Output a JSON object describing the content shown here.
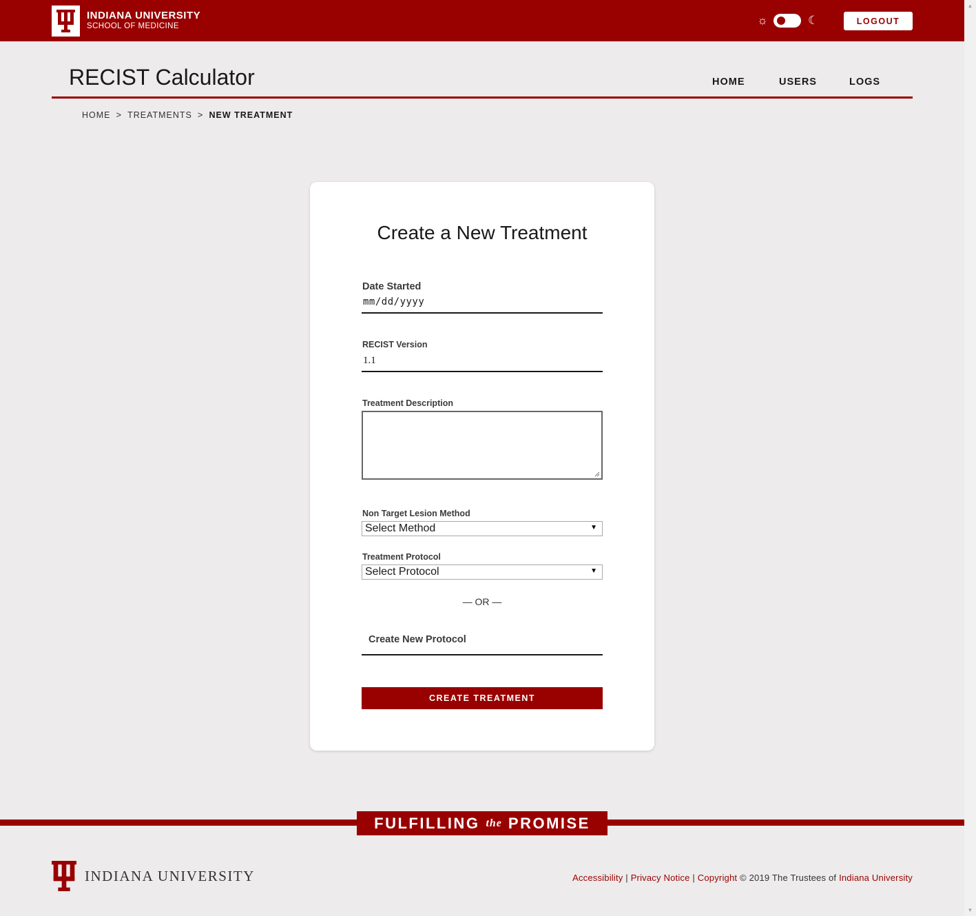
{
  "header": {
    "brand_line1": "INDIANA UNIVERSITY",
    "brand_line2": "SCHOOL OF MEDICINE",
    "logout_label": "LOGOUT",
    "brand_color": "#990000"
  },
  "site": {
    "title": "RECIST Calculator"
  },
  "nav": {
    "items": [
      {
        "label": "HOME"
      },
      {
        "label": "USERS"
      },
      {
        "label": "LOGS"
      }
    ]
  },
  "breadcrumb": {
    "items": [
      "HOME",
      "TREATMENTS",
      "NEW TREATMENT"
    ],
    "separator": ">"
  },
  "form": {
    "title": "Create a New Treatment",
    "date_label": "Date Started",
    "date_placeholder": "mm/dd/yyyy",
    "recist_label": "RECIST Version",
    "recist_value": "1.1",
    "description_label": "Treatment Description",
    "description_value": "",
    "nontarget_label": "Non Target Lesion Method",
    "nontarget_selected": "Select Method",
    "protocol_label": "Treatment Protocol",
    "protocol_selected": "Select Protocol",
    "or_text": "— OR —",
    "new_protocol_placeholder": "Create New Protocol",
    "submit_label": "CREATE TREATMENT"
  },
  "footer": {
    "promise_part1": "FULFILLING",
    "promise_the": "the",
    "promise_part2": "PROMISE",
    "logo_text": "INDIANA UNIVERSITY",
    "link_accessibility": "Accessibility",
    "divider": "|",
    "link_privacy": "Privacy Notice",
    "link_copyright": "Copyright",
    "copyright_text": "© 2019 The Trustees of",
    "link_iu": "Indiana University"
  }
}
